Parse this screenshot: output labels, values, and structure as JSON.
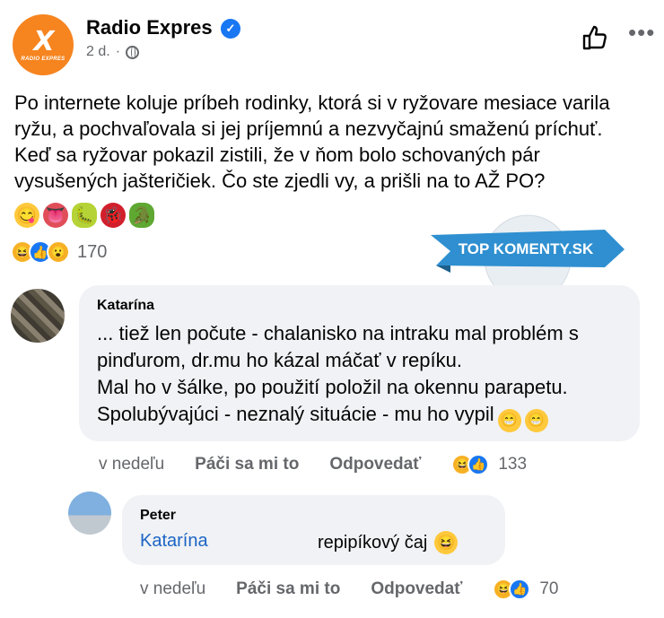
{
  "post": {
    "page_name": "Radio Expres",
    "logo_text": "X",
    "logo_brand": "RADIO EXPRES",
    "time": "2 d.",
    "meta_separator": "·",
    "text": "Po internete koluje príbeh rodinky, ktorá si v ryžovare mesiace varila ryžu, a pochvaľovala si jej príjemnú a nezvyčajnú smaženú príchuť. Keď sa ryžovar pokazil zistili, že v ňom bolo schovaných pár vysušených jašteričiek. Čo ste zjedli vy, a prišli na to AŽ PO?",
    "emojis": [
      "😋",
      "👅",
      "🐛",
      "🐞",
      "🐊"
    ],
    "reaction_count": "170",
    "banner_text": "TOP KOMENTY.SK",
    "more_label": "•••"
  },
  "comments": [
    {
      "author": "Katarína",
      "text_lines": [
        "... tiež len počute - chalanisko na intraku mal problém s",
        "pinďurom, dr.mu ho kázal máčať v repíku.",
        "Mal ho v šálke, po použití položil na okennu parapetu.",
        "Spolubývajúci - neznalý situácie -  mu ho vypil"
      ],
      "trailing_emojis": [
        "😁",
        "😁"
      ],
      "time": "v nedeľu",
      "like_label": "Páči sa mi to",
      "reply_label": "Odpovedať",
      "reaction_count": "133"
    },
    {
      "author": "Peter",
      "mention": "Katarína",
      "text": "repipíkový čaj",
      "emoji": "😆",
      "time": "v nedeľu",
      "like_label": "Páči sa mi to",
      "reply_label": "Odpovedať",
      "reaction_count": "70"
    }
  ],
  "colors": {
    "brand_orange": "#f6841f",
    "facebook_blue": "#1877f2",
    "muted_text": "#65676b",
    "bubble_bg": "#f0f2f5",
    "mention_blue": "#1c64c4",
    "banner_blue": "#2f8fd0"
  },
  "icons": {
    "verified": "verified-badge-icon",
    "globe": "globe-icon",
    "like": "thumbs-up-icon",
    "more": "more-options-icon"
  }
}
